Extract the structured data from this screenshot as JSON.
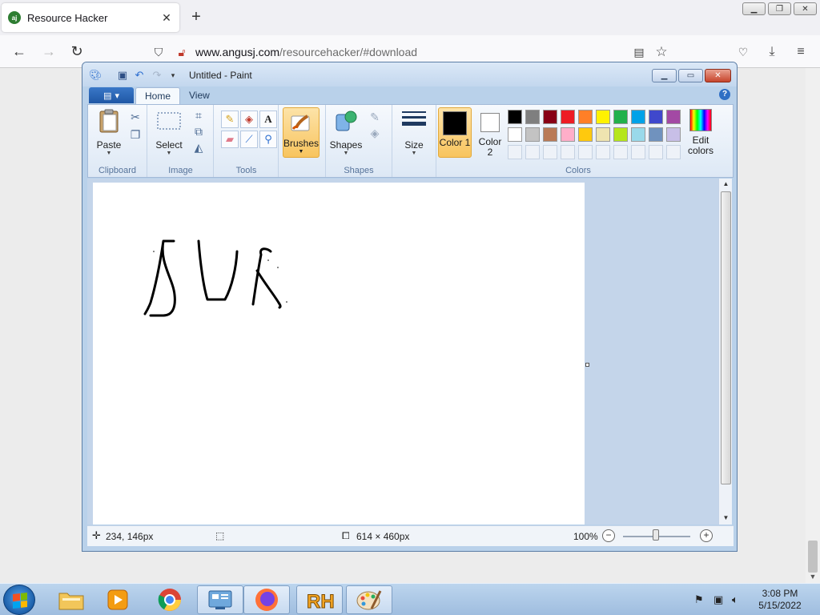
{
  "browser": {
    "tab_title": "Resource Hacker",
    "tab_favicon_text": "aj",
    "url_domain": "www.angusj.com",
    "url_path": "/resourcehacker/#download"
  },
  "paint": {
    "window_title": "Untitled - Paint",
    "file_menu_icon": "paint-menu-icon",
    "tabs": [
      "Home",
      "View"
    ],
    "ribbon": {
      "paste_label": "Paste",
      "select_label": "Select",
      "brushes_label": "Brushes",
      "shapes_label": "Shapes",
      "size_label": "Size",
      "color1_label": "Color 1",
      "color2_label": "Color 2",
      "edit_colors_label": "Edit colors",
      "groups": {
        "clipboard": "Clipboard",
        "image": "Image",
        "tools": "Tools",
        "shapes": "Shapes",
        "colors": "Colors"
      },
      "color1_value": "#000000",
      "color2_value": "#ffffff",
      "palette": [
        "#000000",
        "#7f7f7f",
        "#880015",
        "#ed1c24",
        "#ff7f27",
        "#fff200",
        "#22b14c",
        "#00a2e8",
        "#3f48cc",
        "#a349a4",
        "#ffffff",
        "#c3c3c3",
        "#b97a57",
        "#ffaec9",
        "#ffc90e",
        "#efe4b0",
        "#b5e61d",
        "#99d9ea",
        "#7092be",
        "#c8bfe7",
        "",
        "",
        "",
        "",
        "",
        "",
        "",
        "",
        "",
        ""
      ]
    },
    "canvas_drawing_text": "SUR",
    "status": {
      "cursor_pos": "234, 146px",
      "image_size": "614 × 460px",
      "zoom": "100%"
    }
  },
  "taskbar": {
    "apps": [
      "file-explorer",
      "media-player",
      "chrome",
      "control-panel",
      "firefox",
      "resource-hacker",
      "paint"
    ],
    "time": "3:08 PM",
    "date": "5/15/2022"
  }
}
